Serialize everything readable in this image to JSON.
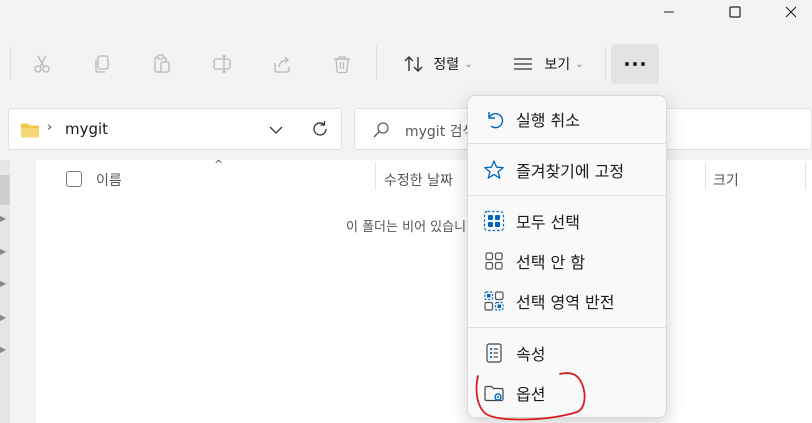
{
  "window": {
    "controls": [
      "minimize",
      "maximize",
      "close"
    ]
  },
  "toolbar": {
    "sort_label": "정렬",
    "view_label": "보기",
    "items": [
      "cut-icon",
      "copy-icon",
      "paste-icon",
      "rename-icon",
      "share-icon",
      "delete-icon"
    ]
  },
  "address": {
    "path": "mygit"
  },
  "search": {
    "placeholder": "mygit 검색"
  },
  "columns": {
    "name": "이름",
    "modified": "수정한 날짜",
    "size": "크기"
  },
  "content": {
    "empty_message": "이 폴더는 비어 있습니다."
  },
  "menu": {
    "items": [
      {
        "label": "실행 취소",
        "icon": "undo-icon"
      },
      {
        "label": "즐겨찾기에 고정",
        "icon": "star-icon"
      },
      {
        "label": "모두 선택",
        "icon": "select-all-icon"
      },
      {
        "label": "선택 안 함",
        "icon": "select-none-icon"
      },
      {
        "label": "선택 영역 반전",
        "icon": "invert-selection-icon"
      },
      {
        "label": "속성",
        "icon": "properties-icon"
      },
      {
        "label": "옵션",
        "icon": "options-icon"
      }
    ]
  },
  "colors": {
    "accent": "#0067c0",
    "annotation": "#d62020"
  }
}
